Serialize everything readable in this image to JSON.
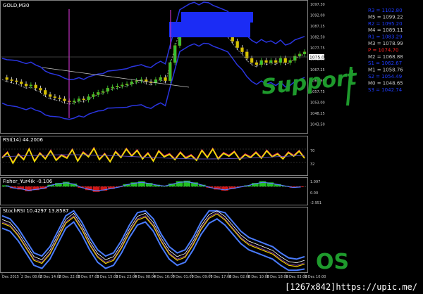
{
  "main_chart": {
    "symbol_label": "GOLD,M30",
    "price_scale": [
      "1097.30",
      "1092.00",
      "1087.25",
      "1082.50",
      "1077.75",
      "1073.00",
      "1067.25",
      "1062.50",
      "1057.75",
      "1053.00",
      "1048.25",
      "1043.50"
    ],
    "current_price": "1075.00",
    "pivot_levels": [
      {
        "name": "R3",
        "value": "1102.80",
        "color": "#1e3cff"
      },
      {
        "name": "M5",
        "value": "1099.22",
        "color": "#c8c8c8"
      },
      {
        "name": "R2",
        "value": "1095.20",
        "color": "#1e3cff"
      },
      {
        "name": "M4",
        "value": "1089.11",
        "color": "#c8c8c8"
      },
      {
        "name": "R1",
        "value": "1083.29",
        "color": "#1e3cff"
      },
      {
        "name": "M3",
        "value": "1078.99",
        "color": "#c8c8c8"
      },
      {
        "name": "P",
        "value": "1074.70",
        "color": "#ff2020"
      },
      {
        "name": "M2",
        "value": "1068.88",
        "color": "#c8c8c8"
      },
      {
        "name": "S1",
        "value": "1062.67",
        "color": "#1e3cff"
      },
      {
        "name": "M1",
        "value": "1058.76",
        "color": "#c8c8c8"
      },
      {
        "name": "S2",
        "value": "1054.49",
        "color": "#1e3cff"
      },
      {
        "name": "M0",
        "value": "1048.65",
        "color": "#c8c8c8"
      },
      {
        "name": "S3",
        "value": "1042.74",
        "color": "#1e3cff"
      }
    ],
    "annotation": "Support"
  },
  "indicators": {
    "rsi_label": "RSI(14) 44.2006",
    "rsi_scale": [
      "70",
      "32"
    ],
    "fisher_label": "Fisher_Yur4ik -0.106",
    "fisher_scale": [
      "1.097",
      "0.00",
      "-2.951"
    ],
    "stoch_label": "StochRSI 10.4297 13.8587",
    "stoch_annotation": "OS"
  },
  "time_axis": [
    "Dec 2015",
    "2 Dec 08:00",
    "2 Dec 14:00",
    "2 Dec 22:00",
    "3 Dec 07:00",
    "3 Dec 15:00",
    "3 Dec 23:00",
    "4 Dec 08:00",
    "4 Dec 16:00",
    "7 Dec 01:00",
    "7 Dec 09:00",
    "7 Dec 17:00",
    "8 Dec 02:00",
    "8 Dec 10:00",
    "8 Dec 18:00",
    "9 Dec 03:00",
    "9 Dec 10:00"
  ],
  "watermark": "[1267x842]https://upic.me/",
  "chart_data": [
    {
      "type": "line",
      "title": "GOLD,M30",
      "xlabel": "",
      "ylabel": "",
      "ylim": [
        1038,
        1098
      ],
      "series": [
        {
          "name": "Price",
          "values": [
            1063,
            1062,
            1061.5,
            1061,
            1060,
            1059,
            1059.5,
            1058,
            1057,
            1055,
            1054,
            1053.5,
            1053,
            1052,
            1051.5,
            1052,
            1053,
            1052.5,
            1054,
            1055,
            1056,
            1056.5,
            1058,
            1058.5,
            1059,
            1059.5,
            1060,
            1061,
            1061.5,
            1062,
            1061,
            1060.5,
            1062,
            1063,
            1061.5,
            1070,
            1078,
            1086,
            1087,
            1088,
            1088.5,
            1087,
            1088,
            1087.5,
            1086,
            1085,
            1084,
            1083,
            1080,
            1077,
            1075,
            1072,
            1070,
            1069,
            1071,
            1070,
            1071,
            1070,
            1072,
            1070,
            1071,
            1073,
            1074,
            1075
          ]
        }
      ]
    },
    {
      "type": "line",
      "title": "RSI(14) 44.2006",
      "ylim": [
        0,
        100
      ],
      "series": [
        {
          "name": "RSI",
          "values": [
            45,
            60,
            30,
            55,
            40,
            70,
            35,
            58,
            42,
            65,
            38,
            52,
            44,
            68,
            36,
            60,
            48,
            72,
            40,
            56,
            34,
            62,
            46,
            70,
            50,
            66,
            42,
            58,
            36,
            64,
            48,
            55,
            40,
            60,
            44,
            52,
            38,
            66,
            46,
            70,
            42,
            58,
            50,
            62,
            40,
            54,
            46,
            60,
            44,
            65,
            48,
            56,
            42,
            60,
            50,
            64,
            44
          ]
        }
      ]
    },
    {
      "type": "bar",
      "title": "Fisher_Yur4ik -0.106",
      "ylim": [
        -2.951,
        1.097
      ],
      "series": [
        {
          "name": "Fisher",
          "values": [
            0.2,
            -0.3,
            -0.5,
            -0.8,
            -0.6,
            -0.4,
            0.3,
            0.6,
            0.8,
            0.5,
            -0.2,
            -0.6,
            -0.9,
            -0.7,
            -0.4,
            -0.1,
            0.4,
            0.7,
            0.9,
            0.6,
            0.3,
            0.1,
            0.5,
            0.9,
            1.0,
            0.7,
            0.3,
            -0.2,
            -0.5,
            -0.7,
            -0.4,
            -0.1,
            0.2,
            0.6,
            0.9,
            0.7,
            0.4,
            0.1,
            -0.2,
            -0.1
          ]
        }
      ]
    },
    {
      "type": "line",
      "title": "StochRSI 10.4297 13.8587",
      "ylim": [
        0,
        100
      ],
      "series": [
        {
          "name": "StochRSI",
          "values": [
            80,
            75,
            60,
            40,
            20,
            15,
            30,
            55,
            80,
            90,
            70,
            45,
            25,
            15,
            20,
            40,
            65,
            85,
            90,
            75,
            50,
            30,
            20,
            25,
            45,
            70,
            88,
            95,
            85,
            70,
            55,
            45,
            40,
            35,
            30,
            20,
            12,
            10,
            14
          ]
        }
      ]
    }
  ]
}
